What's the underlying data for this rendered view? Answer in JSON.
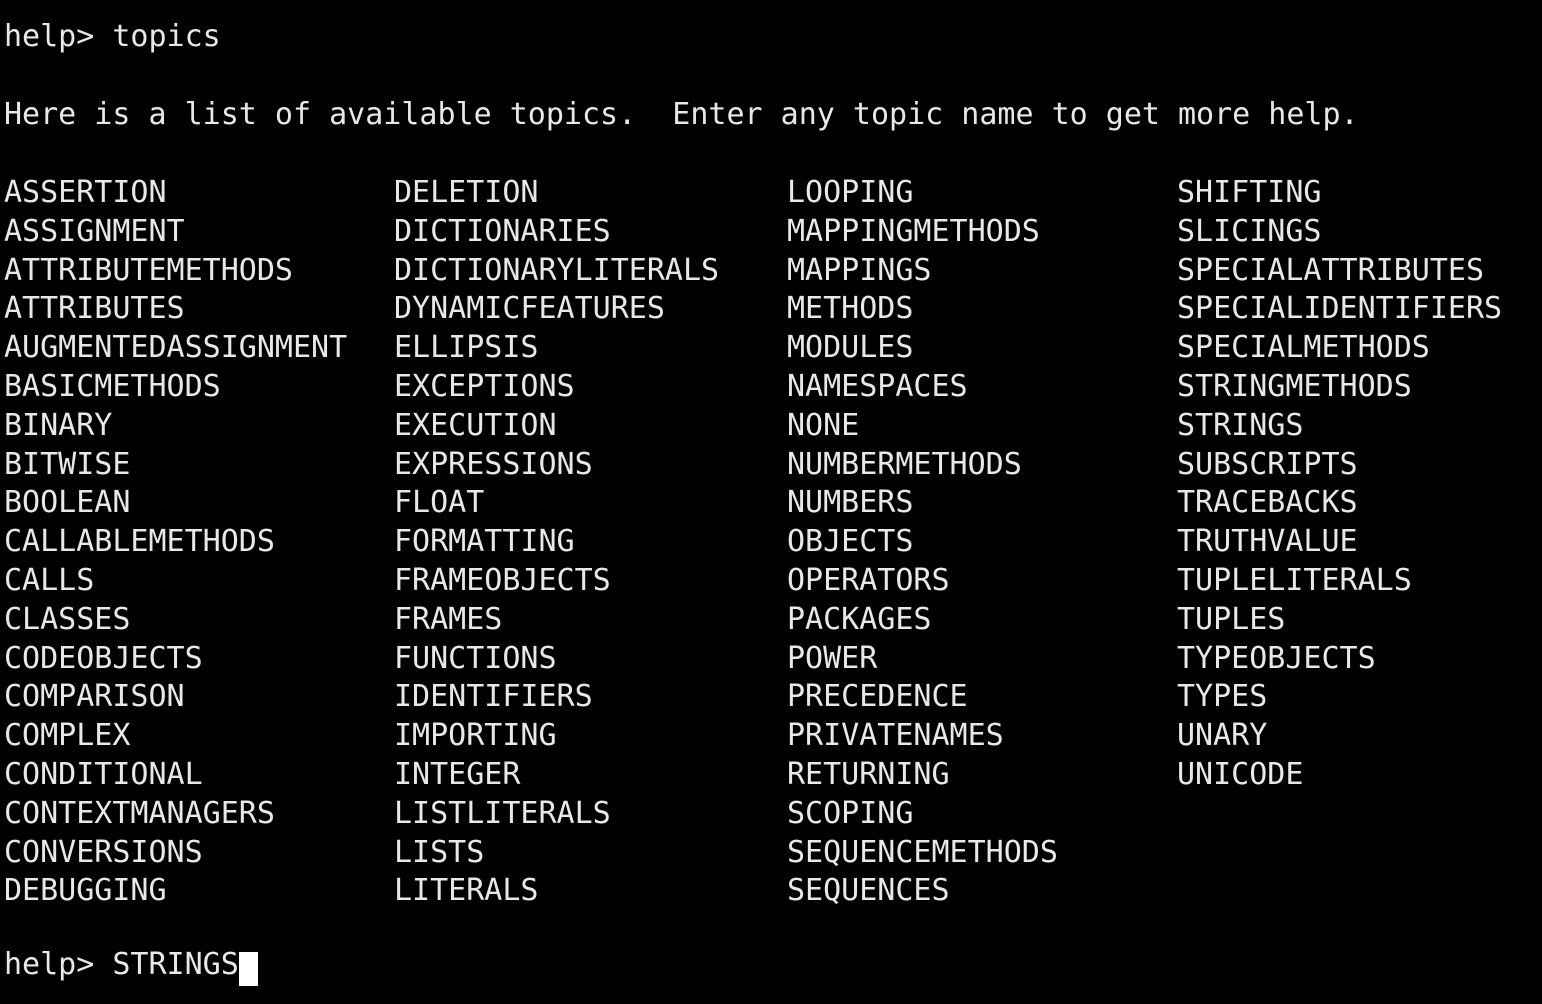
{
  "terminal": {
    "background_color": "#000000",
    "foreground_color": "#e8e8e8",
    "cursor_color": "#ffffff"
  },
  "prompt_top": {
    "prompt": "help> ",
    "command": "topics",
    "full_line": "help> topics"
  },
  "intro": {
    "text": "Here is a list of available topics.  Enter any topic name to get more help."
  },
  "prompt_bottom": {
    "prompt": "help> ",
    "command": "STRINGS",
    "full_line": "help> STRINGS",
    "cursor": "block-cursor"
  },
  "topics": {
    "columns": [
      {
        "index": 0,
        "items": [
          "ASSERTION",
          "ASSIGNMENT",
          "ATTRIBUTEMETHODS",
          "ATTRIBUTES",
          "AUGMENTEDASSIGNMENT",
          "BASICMETHODS",
          "BINARY",
          "BITWISE",
          "BOOLEAN",
          "CALLABLEMETHODS",
          "CALLS",
          "CLASSES",
          "CODEOBJECTS",
          "COMPARISON",
          "COMPLEX",
          "CONDITIONAL",
          "CONTEXTMANAGERS",
          "CONVERSIONS",
          "DEBUGGING"
        ]
      },
      {
        "index": 1,
        "items": [
          "DELETION",
          "DICTIONARIES",
          "DICTIONARYLITERALS",
          "DYNAMICFEATURES",
          "ELLIPSIS",
          "EXCEPTIONS",
          "EXECUTION",
          "EXPRESSIONS",
          "FLOAT",
          "FORMATTING",
          "FRAMEOBJECTS",
          "FRAMES",
          "FUNCTIONS",
          "IDENTIFIERS",
          "IMPORTING",
          "INTEGER",
          "LISTLITERALS",
          "LISTS",
          "LITERALS"
        ]
      },
      {
        "index": 2,
        "items": [
          "LOOPING",
          "MAPPINGMETHODS",
          "MAPPINGS",
          "METHODS",
          "MODULES",
          "NAMESPACES",
          "NONE",
          "NUMBERMETHODS",
          "NUMBERS",
          "OBJECTS",
          "OPERATORS",
          "PACKAGES",
          "POWER",
          "PRECEDENCE",
          "PRIVATENAMES",
          "RETURNING",
          "SCOPING",
          "SEQUENCEMETHODS",
          "SEQUENCES"
        ]
      },
      {
        "index": 3,
        "items": [
          "SHIFTING",
          "SLICINGS",
          "SPECIALATTRIBUTES",
          "SPECIALIDENTIFIERS",
          "SPECIALMETHODS",
          "STRINGMETHODS",
          "STRINGS",
          "SUBSCRIPTS",
          "TRACEBACKS",
          "TRUTHVALUE",
          "TUPLELITERALS",
          "TUPLES",
          "TYPEOBJECTS",
          "TYPES",
          "UNARY",
          "UNICODE"
        ]
      }
    ]
  }
}
